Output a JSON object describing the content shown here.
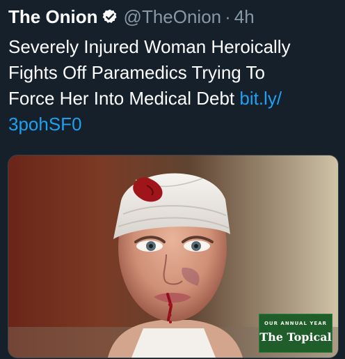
{
  "tweet": {
    "display_name": "The Onion",
    "handle": "@TheOnion",
    "separator": "·",
    "time": "4h",
    "text_lines": [
      "Severely Injured Woman Heroically",
      "Fights Off Paramedics Trying To",
      "Force Her Into Medical Debt "
    ],
    "link_part1": "bit.ly/",
    "link_part2": "3pohSF0",
    "verified_icon": "verified-check-icon"
  },
  "media": {
    "promo_small": "OUR ANNUAL YEAR",
    "promo_title": "The Topical"
  },
  "colors": {
    "background": "#15202b",
    "text": "#ffffff",
    "muted": "#8899a6",
    "link": "#1da1f2",
    "promo_green": "#1f5d2b"
  }
}
